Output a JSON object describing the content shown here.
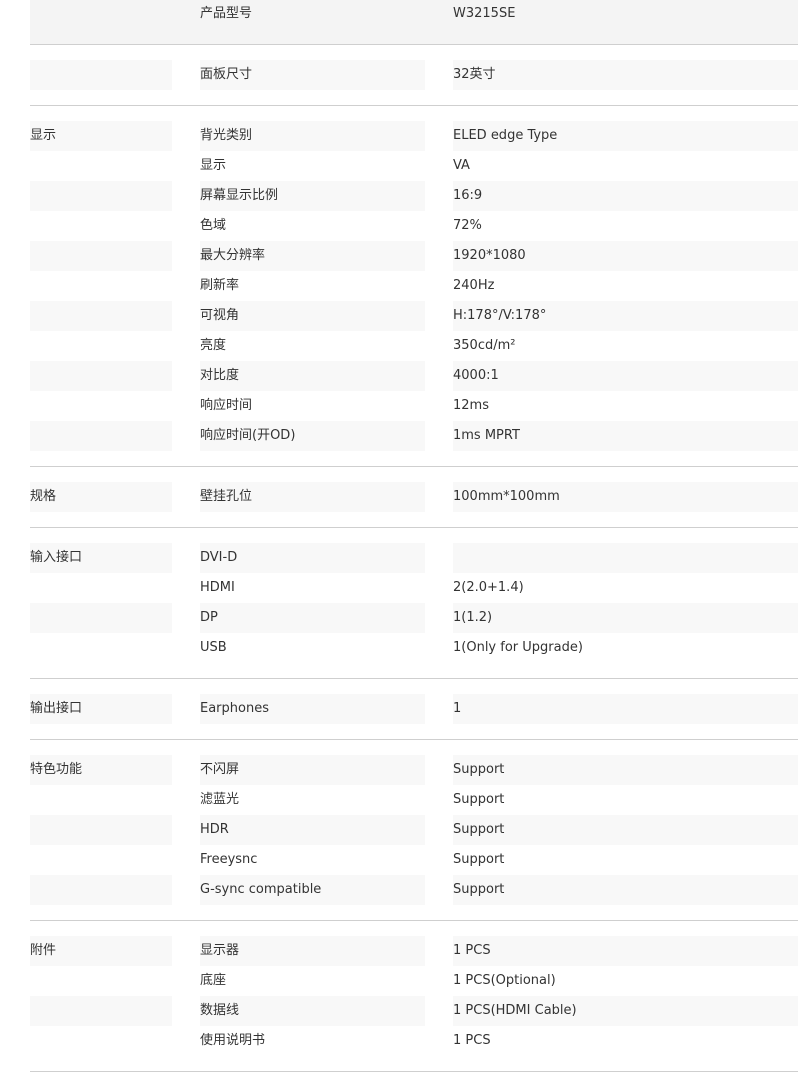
{
  "groups": [
    {
      "label": "",
      "rows": [
        [
          "产品型号",
          "W3215SE"
        ]
      ]
    },
    {
      "label": "",
      "rows": [
        [
          "面板尺寸",
          "32英寸"
        ]
      ]
    },
    {
      "label": "显示",
      "rows": [
        [
          "背光类别",
          "ELED edge Type"
        ],
        [
          "显示",
          "VA"
        ],
        [
          "屏幕显示比例",
          "16:9"
        ],
        [
          "色域",
          "72%"
        ],
        [
          "最大分辨率",
          "1920*1080"
        ],
        [
          "刷新率",
          "240Hz"
        ],
        [
          "可视角",
          "H:178°/V:178°"
        ],
        [
          "亮度",
          "350cd/m²"
        ],
        [
          "对比度",
          "4000:1"
        ],
        [
          "响应时间",
          "12ms"
        ],
        [
          "响应时间(开OD)",
          "1ms MPRT"
        ]
      ]
    },
    {
      "label": "规格",
      "rows": [
        [
          "壁挂孔位",
          "100mm*100mm"
        ]
      ]
    },
    {
      "label": "输入接口",
      "rows": [
        [
          "DVI-D",
          ""
        ],
        [
          "HDMI",
          "2(2.0+1.4)"
        ],
        [
          "DP",
          "1(1.2)"
        ],
        [
          "USB",
          "1(Only for Upgrade)"
        ]
      ]
    },
    {
      "label": "输出接口",
      "rows": [
        [
          "Earphones",
          "1"
        ]
      ]
    },
    {
      "label": "特色功能",
      "rows": [
        [
          "不闪屏",
          "Support"
        ],
        [
          "滤蓝光",
          "Support"
        ],
        [
          "HDR",
          "Support"
        ],
        [
          "Freeysnc",
          "Support"
        ],
        [
          "G-sync compatible",
          "Support"
        ]
      ]
    },
    {
      "label": "附件",
      "rows": [
        [
          "显示器",
          "1 PCS"
        ],
        [
          "底座",
          "1 PCS(Optional)"
        ],
        [
          "数据线",
          "1 PCS(HDMI Cable)"
        ],
        [
          "使用说明书",
          "1 PCS"
        ]
      ]
    }
  ]
}
